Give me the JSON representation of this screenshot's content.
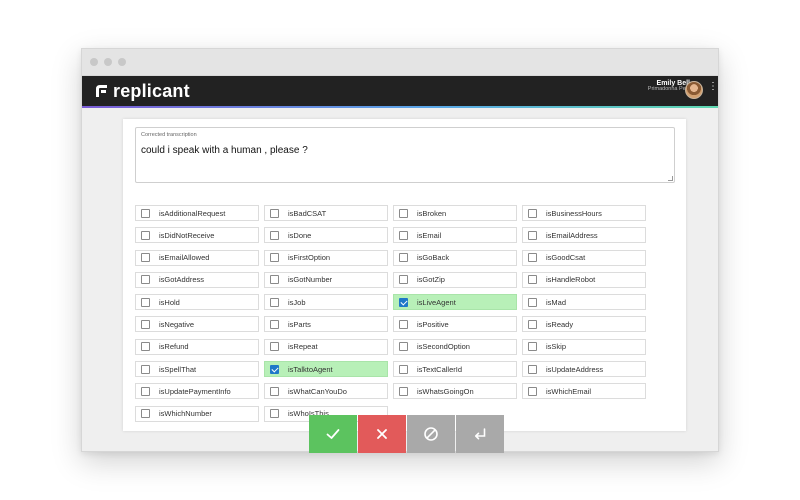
{
  "header": {
    "logo_text": "replicant",
    "user_name": "Emily Bell",
    "user_org": "Primadonna Pets"
  },
  "transcription": {
    "label": "Corrected transcription",
    "value": "could i speak with a human , please ?"
  },
  "intents": [
    {
      "label": "isAdditionalRequest",
      "checked": false
    },
    {
      "label": "isBadCSAT",
      "checked": false
    },
    {
      "label": "isBroken",
      "checked": false
    },
    {
      "label": "isBusinessHours",
      "checked": false
    },
    {
      "label": "isDidNotReceive",
      "checked": false
    },
    {
      "label": "isDone",
      "checked": false
    },
    {
      "label": "isEmail",
      "checked": false
    },
    {
      "label": "isEmailAddress",
      "checked": false
    },
    {
      "label": "isEmailAllowed",
      "checked": false
    },
    {
      "label": "isFirstOption",
      "checked": false
    },
    {
      "label": "isGoBack",
      "checked": false
    },
    {
      "label": "isGoodCsat",
      "checked": false
    },
    {
      "label": "isGotAddress",
      "checked": false
    },
    {
      "label": "isGotNumber",
      "checked": false
    },
    {
      "label": "isGotZip",
      "checked": false
    },
    {
      "label": "isHandleRobot",
      "checked": false
    },
    {
      "label": "isHold",
      "checked": false
    },
    {
      "label": "isJob",
      "checked": false
    },
    {
      "label": "isLiveAgent",
      "checked": true
    },
    {
      "label": "isMad",
      "checked": false
    },
    {
      "label": "isNegative",
      "checked": false
    },
    {
      "label": "isParts",
      "checked": false
    },
    {
      "label": "isPositive",
      "checked": false
    },
    {
      "label": "isReady",
      "checked": false
    },
    {
      "label": "isRefund",
      "checked": false
    },
    {
      "label": "isRepeat",
      "checked": false
    },
    {
      "label": "isSecondOption",
      "checked": false
    },
    {
      "label": "isSkip",
      "checked": false
    },
    {
      "label": "isSpellThat",
      "checked": false
    },
    {
      "label": "isTalktoAgent",
      "checked": true
    },
    {
      "label": "isTextCallerId",
      "checked": false
    },
    {
      "label": "isUpdateAddress",
      "checked": false
    },
    {
      "label": "isUpdatePaymentInfo",
      "checked": false
    },
    {
      "label": "isWhatCanYouDo",
      "checked": false
    },
    {
      "label": "isWhatsGoingOn",
      "checked": false
    },
    {
      "label": "isWhichEmail",
      "checked": false
    },
    {
      "label": "isWhichNumber",
      "checked": false
    },
    {
      "label": "isWhoIsThis",
      "checked": false
    }
  ],
  "actions": [
    {
      "name": "accept-button",
      "icon": "check-icon",
      "color": "#5cc35f"
    },
    {
      "name": "reject-button",
      "icon": "close-icon",
      "color": "#e25a5a"
    },
    {
      "name": "skip-button",
      "icon": "block-icon",
      "color": "#a9a9a9"
    },
    {
      "name": "enter-button",
      "icon": "return-icon",
      "color": "#a9a9a9"
    }
  ],
  "colors": {
    "header_bg": "#222222",
    "checked_row": "#b8f0b8",
    "checkbox_on": "#1f78c8"
  }
}
